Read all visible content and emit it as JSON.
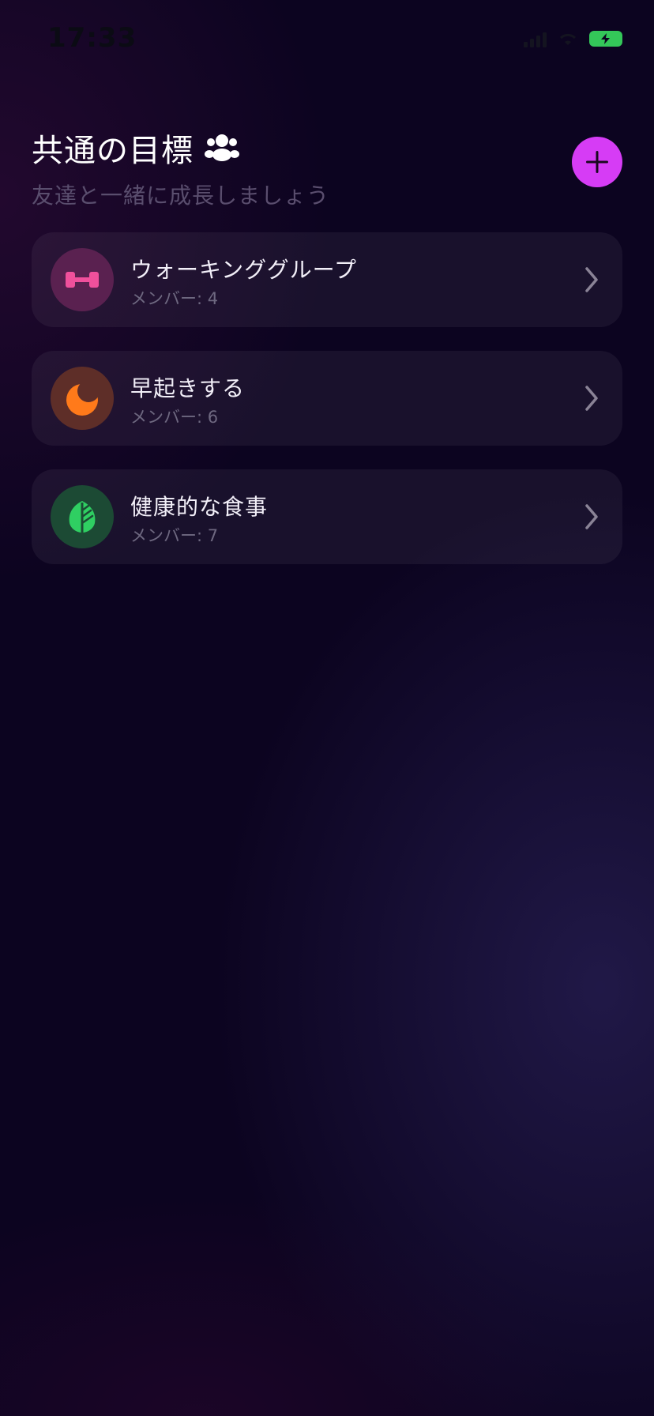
{
  "status": {
    "time": "17:33"
  },
  "header": {
    "title": "共通の目標",
    "subtitle": "友達と一緒に成長しましょう",
    "title_icon": "group-icon",
    "add_icon": "plus-icon"
  },
  "colors": {
    "add_button": "#d63cf5",
    "battery": "#34c759"
  },
  "goals": [
    {
      "name": "ウォーキンググループ",
      "members_label": "メンバー: 4",
      "icon": "dumbbell-icon",
      "icon_color": "#f0509c",
      "icon_bg": "#5a2150"
    },
    {
      "name": "早起きする",
      "members_label": "メンバー: 6",
      "icon": "moon-icon",
      "icon_color": "#ff7a1a",
      "icon_bg": "#5e2e28"
    },
    {
      "name": "健康的な食事",
      "members_label": "メンバー: 7",
      "icon": "leaf-icon",
      "icon_color": "#2fcf62",
      "icon_bg": "#1c4a34"
    }
  ]
}
